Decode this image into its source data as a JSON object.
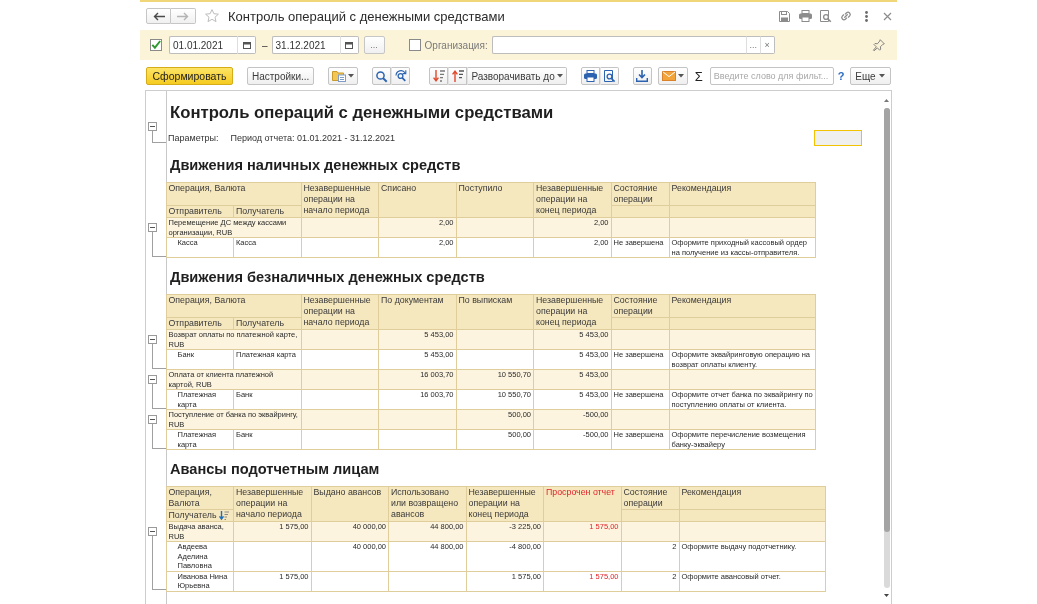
{
  "window": {
    "title": "Контроль операций с денежными средствами",
    "starred": false
  },
  "navigation": {
    "back_enabled": true,
    "forward_enabled": false
  },
  "filters": {
    "period": {
      "checked": true,
      "from": "01.01.2021",
      "separator": "–",
      "to": "31.12.2021",
      "choose_button": "..."
    },
    "organization": {
      "checked": false,
      "label": "Организация:",
      "choose_button": "...",
      "clear_button": "×"
    }
  },
  "toolbar": {
    "generate_button": "Сформировать",
    "settings_button": "Настройки...",
    "expand_button": "Разворачивать до",
    "sum_button": "Σ",
    "search": {
      "placeholder": "Введите слово для фильт..."
    },
    "help_button": "?",
    "more_button": "Еще"
  },
  "report": {
    "title": "Контроль операций с денежными средствами",
    "parameters": {
      "expanded": true,
      "label": "Параметры:",
      "text": "Период отчета: 01.01.2021 - 31.12.2021"
    },
    "empty_cell_selected": true,
    "sections": [
      {
        "heading": "Движения наличных денежных средств",
        "key_column": {
          "label": "Операция, Валюта",
          "subcolumns": {
            "sender": {
              "label": "Отправитель",
              "sorted": false
            },
            "recipient": {
              "label": "Получатель",
              "sorted": false
            }
          }
        },
        "columns": {
          "open_at_start": {
            "label": "Незавершенные операции на начало периода",
            "kind": "amount",
            "alert": false
          },
          "written_off": {
            "label": "Списано",
            "kind": "amount",
            "alert": false
          },
          "received": {
            "label": "Поступило",
            "kind": "amount",
            "alert": false
          },
          "open_at_end": {
            "label": "Незавершенные операции на конец периода",
            "kind": "amount",
            "alert": false
          },
          "state": {
            "label": "Состояние операции",
            "kind": "text",
            "alert": false
          },
          "recommendation": {
            "label": "Рекомендация",
            "kind": "text",
            "alert": false
          }
        },
        "groups": [
          {
            "label": "Перемещение ДС между кассами организации, RUB",
            "expanded": true,
            "totals": {
              "written_off": "2,00",
              "open_at_end": "2,00"
            },
            "rows": [
              {
                "sender": "Касса",
                "recipient": "Касса",
                "written_off": "2,00",
                "open_at_end": "2,00",
                "state": "Не завершена",
                "recommendation": "Оформите приходный кассовый ордер на получение из кассы-отправителя."
              }
            ]
          }
        ]
      },
      {
        "heading": "Движения безналичных денежных средств",
        "key_column": {
          "label": "Операция, Валюта",
          "subcolumns": {
            "sender": {
              "label": "Отправитель",
              "sorted": false
            },
            "recipient": {
              "label": "Получатель",
              "sorted": false
            }
          }
        },
        "columns": {
          "open_at_start": {
            "label": "Незавершенные операции на начало периода",
            "kind": "amount",
            "alert": false
          },
          "by_documents": {
            "label": "По документам",
            "kind": "amount",
            "alert": false
          },
          "by_statements": {
            "label": "По выпискам",
            "kind": "amount",
            "alert": false
          },
          "open_at_end": {
            "label": "Незавершенные операции на конец периода",
            "kind": "amount",
            "alert": false
          },
          "state": {
            "label": "Состояние операции",
            "kind": "text",
            "alert": false
          },
          "recommendation": {
            "label": "Рекомендация",
            "kind": "text",
            "alert": false
          }
        },
        "groups": [
          {
            "label": "Возврат оплаты по платежной карте, RUB",
            "expanded": true,
            "totals": {
              "by_documents": "5 453,00",
              "open_at_end": "5 453,00"
            },
            "rows": [
              {
                "sender": "Банк",
                "recipient": "Платежная карта",
                "by_documents": "5 453,00",
                "open_at_end": "5 453,00",
                "state": "Не завершена",
                "recommendation": "Оформите эквайринговую операцию на возврат оплаты клиенту."
              }
            ]
          },
          {
            "label": "Оплата от клиента платежной картой, RUB",
            "expanded": true,
            "totals": {
              "by_documents": "16 003,70",
              "by_statements": "10 550,70",
              "open_at_end": "5 453,00"
            },
            "rows": [
              {
                "sender": "Платежная карта",
                "recipient": "Банк",
                "by_documents": "16 003,70",
                "by_statements": "10 550,70",
                "open_at_end": "5 453,00",
                "state": "Не завершена",
                "recommendation": "Оформите отчет банка по эквайрингу по поступлению оплаты от клиента."
              }
            ]
          },
          {
            "label": "Поступление от банка по эквайрингу, RUB",
            "expanded": true,
            "totals": {
              "by_statements": "500,00",
              "open_at_end": "-500,00"
            },
            "rows": [
              {
                "sender": "Платежная карта",
                "recipient": "Банк",
                "by_statements": "500,00",
                "open_at_end": "-500,00",
                "state": "Не завершена",
                "recommendation": "Оформите перечисление возмещения банку-эквайеру"
              }
            ]
          }
        ]
      },
      {
        "heading": "Авансы подотчетным лицам",
        "key_column": {
          "label": "Операция, Валюта",
          "subcolumns": {
            "recipient": {
              "label": "Получатель",
              "sorted": true
            }
          }
        },
        "columns": {
          "open_at_start": {
            "label": "Незавершенные операции на начало периода",
            "kind": "amount",
            "alert": false
          },
          "issued": {
            "label": "Выдано авансов",
            "kind": "amount",
            "alert": false
          },
          "used_or_returned": {
            "label": "Использовано или возвращено авансов",
            "kind": "amount",
            "alert": false
          },
          "open_at_end": {
            "label": "Незавершенные операции на конец периода",
            "kind": "amount",
            "alert": false
          },
          "overdue_report": {
            "label": "Просрочен отчет",
            "kind": "amount",
            "alert": true
          },
          "state": {
            "label": "Состояние операции",
            "kind": "code",
            "alert": false
          },
          "recommendation": {
            "label": "Рекомендация",
            "kind": "text",
            "alert": false
          }
        },
        "groups": [
          {
            "label": "Выдача аванса, RUB",
            "expanded": true,
            "totals": {
              "open_at_start": "1 575,00",
              "issued": "40 000,00",
              "used_or_returned": "44 800,00",
              "open_at_end": "-3 225,00",
              "overdue_report": "1 575,00"
            },
            "rows": [
              {
                "recipient": "Авдеева Аделина Павловна",
                "issued": "40 000,00",
                "used_or_returned": "44 800,00",
                "open_at_end": "-4 800,00",
                "state": "2",
                "recommendation": "Оформите выдачу подотчетнику."
              },
              {
                "recipient": "Иванова Нина Юрьевна",
                "open_at_start": "1 575,00",
                "open_at_end": "1 575,00",
                "overdue_report": "1 575,00",
                "state": "2",
                "recommendation": "Оформите авансовый отчет."
              }
            ]
          }
        ]
      }
    ]
  }
}
